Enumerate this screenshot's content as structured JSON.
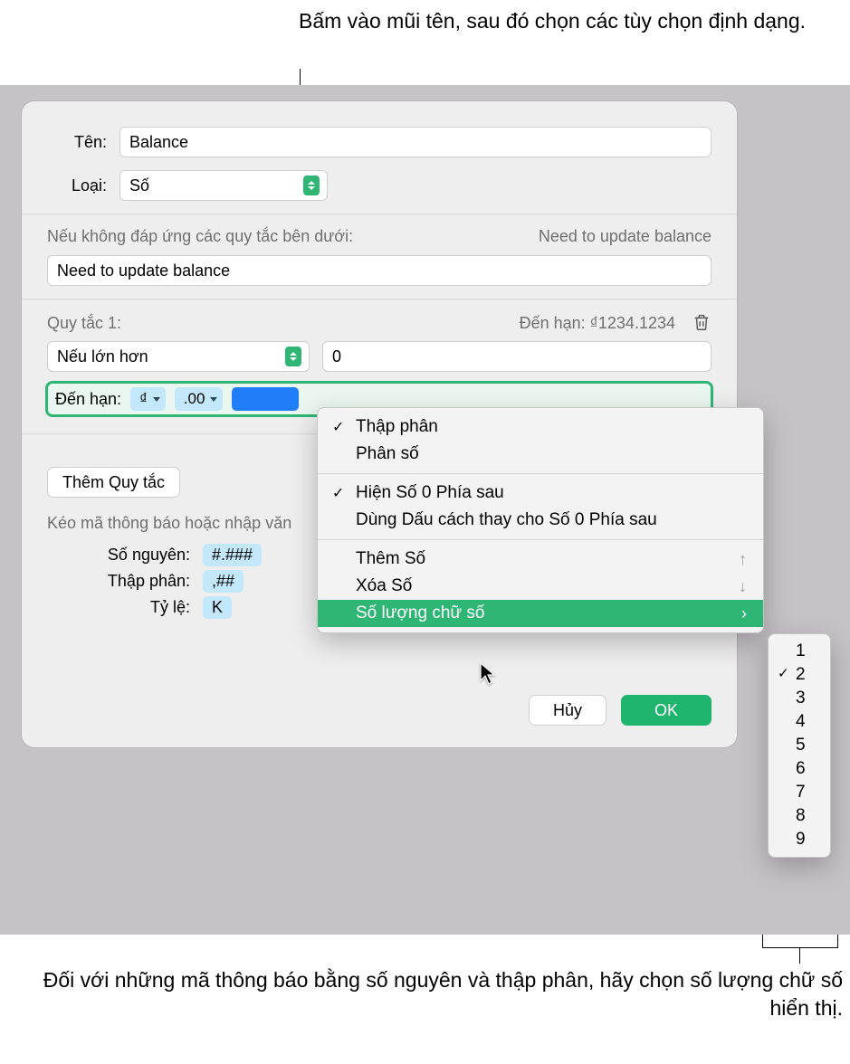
{
  "callouts": {
    "top": "Bấm vào mũi tên, sau đó chọn các tùy chọn định dạng.",
    "bottom": "Đối với những mã thông báo bằng số nguyên và thập phân, hãy chọn số lượng chữ số hiển thị."
  },
  "form": {
    "name_label": "Tên:",
    "name_value": "Balance",
    "type_label": "Loại:",
    "type_value": "Số",
    "fallback_label": "Nếu không đáp ứng các quy tắc bên dưới:",
    "fallback_preview": "Need to update balance",
    "fallback_value": "Need to update balance"
  },
  "rule": {
    "title": "Quy tắc 1:",
    "preview_label": "Đến hạn: ₫1234.1234",
    "condition": "Nếu lớn hơn",
    "condition_value": "0",
    "output_label": "Đến hạn:",
    "token_currency": "₫",
    "token_decimals": ".00"
  },
  "addRule": "Thêm Quy tắc",
  "dragText": "Kéo mã thông báo hoặc nhập văn",
  "tokens": {
    "integer_label": "Số nguyên:",
    "integer_value": "#.###",
    "decimal_label": "Thập phân:",
    "decimal_value": ",##",
    "scale_label": "Tỷ lệ:",
    "scale_value": "K"
  },
  "buttons": {
    "cancel": "Hủy",
    "ok": "OK"
  },
  "popup": {
    "decimal": "Thập phân",
    "fraction": "Phân số",
    "trailing_zeros": "Hiện Số 0 Phía sau",
    "space_zeros": "Dùng Dấu cách thay cho Số 0 Phía sau",
    "add_digit": "Thêm Số",
    "remove_digit": "Xóa Số",
    "digit_count": "Số lượng chữ số"
  },
  "submenu": {
    "items": [
      "1",
      "2",
      "3",
      "4",
      "5",
      "6",
      "7",
      "8",
      "9"
    ],
    "selected": "2"
  }
}
